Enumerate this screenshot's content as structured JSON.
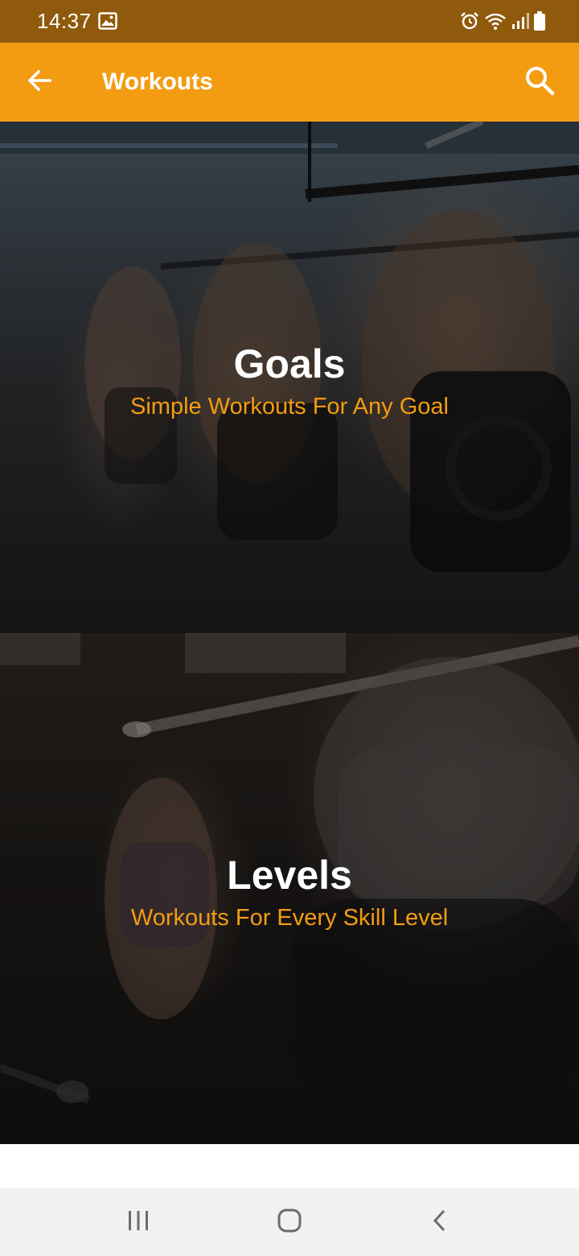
{
  "status_bar": {
    "time": "14:37",
    "icons": [
      "image-icon",
      "alarm-icon",
      "wifi-icon",
      "signal-icon",
      "battery-icon"
    ]
  },
  "app_bar": {
    "title": "Workouts",
    "back_icon": "arrow-left-icon",
    "search_icon": "search-icon",
    "background_color": "#f39c12"
  },
  "cards": [
    {
      "title": "Goals",
      "subtitle": "Simple Workouts For Any Goal"
    },
    {
      "title": "Levels",
      "subtitle": "Workouts For Every Skill Level"
    }
  ],
  "accent_color": "#f39c12",
  "nav_bar": {
    "icons": [
      "recent-apps-icon",
      "home-icon",
      "back-chevron-icon"
    ]
  }
}
